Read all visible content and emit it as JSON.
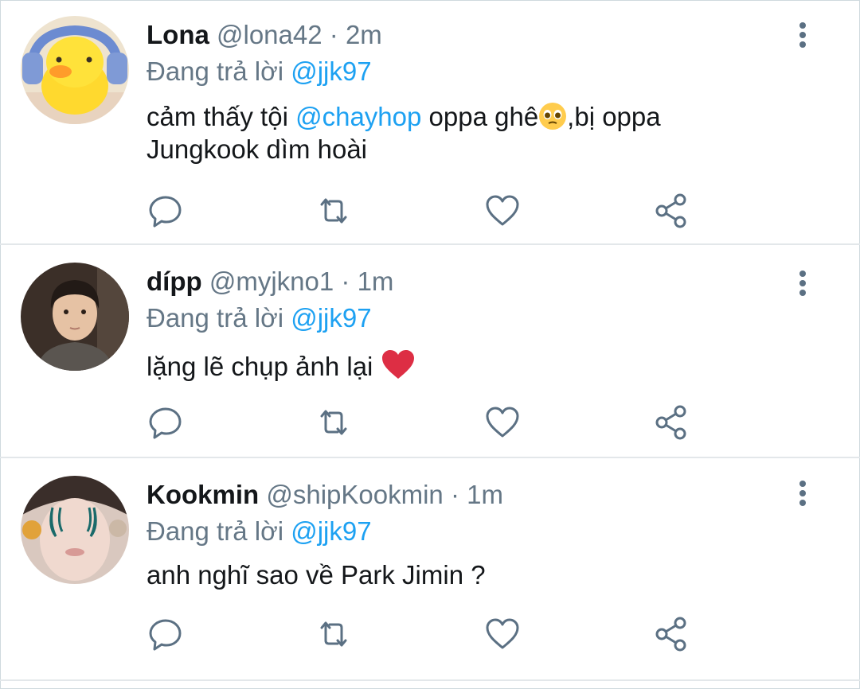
{
  "colors": {
    "accent": "#1da1f2",
    "secondary_text": "#657786",
    "primary_text": "#14171a",
    "icon": "#5b7083",
    "divider": "#e3e7ea"
  },
  "tweets": [
    {
      "name": "Lona",
      "handle": "@lona42",
      "separator": "·",
      "time": "2m",
      "reply_prefix": "Đang trả lời",
      "reply_to": "@jjk97",
      "body_before": "cảm thấy tội",
      "body_mention": "@chayhop",
      "body_after_line1": "oppa ghê",
      "body_after_emoji": ",bị oppa",
      "body_line2": "Jungkook dìm hoài",
      "emoji": "pleading-face",
      "avatar": "yellow-duck-with-headphones-avatar"
    },
    {
      "name": "dípp",
      "handle": "@myjkno1",
      "separator": "·",
      "time": "1m",
      "reply_prefix": "Đang trả lời",
      "reply_to": "@jjk97",
      "body": "lặng lẽ chụp ảnh lại",
      "emoji": "red-heart",
      "avatar": "person-photo-avatar"
    },
    {
      "name": "Kookmin",
      "handle": "@shipKookmin",
      "separator": "·",
      "time": "1m",
      "reply_prefix": "Đang trả lời",
      "reply_to": "@jjk97",
      "body": "anh nghĩ sao về Park Jimin ?",
      "avatar": "crying-face-sticker-avatar"
    }
  ],
  "actions": [
    "reply-icon",
    "retweet-icon",
    "like-icon",
    "share-icon"
  ],
  "menu_icon": "more-vertical-icon"
}
